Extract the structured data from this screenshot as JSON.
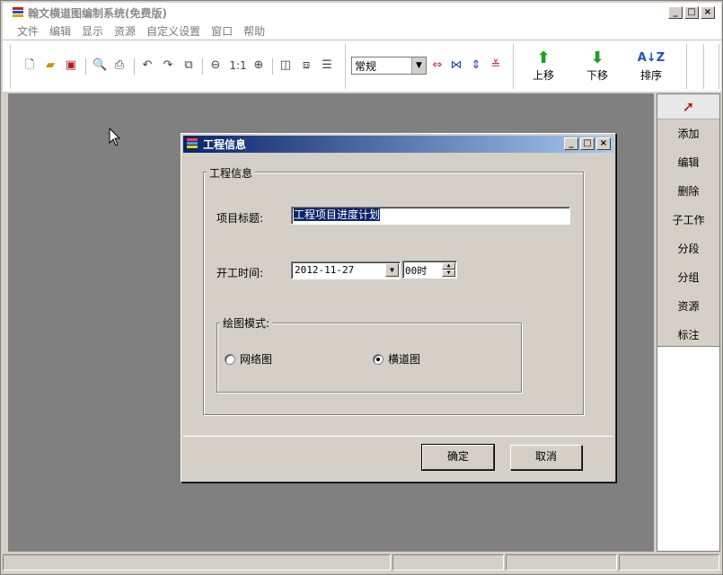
{
  "app": {
    "title": "翰文横道图编制系统(免费版)"
  },
  "menu": [
    "文件",
    "编辑",
    "显示",
    "资源",
    "自定义设置",
    "窗口",
    "帮助"
  ],
  "toolbar": {
    "zoom_label": "1:1",
    "style_combo": "常规",
    "move_up": "上移",
    "move_down": "下移",
    "sort": "排序"
  },
  "side_panel": {
    "items": [
      "添加",
      "编辑",
      "删除",
      "子工作",
      "分段",
      "分组",
      "资源",
      "标注"
    ]
  },
  "dialog": {
    "title": "工程信息",
    "group_label": "工程信息",
    "project_title_label": "项目标题:",
    "project_title_value": "工程项目进度计划",
    "start_time_label": "开工时间:",
    "start_date_value": "2012-11-27",
    "start_hour_value": "00时",
    "mode_group_label": "绘图模式:",
    "mode_network": "网络图",
    "mode_gantt": "横道图",
    "mode_selected": "横道图",
    "ok": "确定",
    "cancel": "取消"
  },
  "colors": {
    "dialog_title_start": "#0a246a",
    "dialog_title_end": "#a6caf0",
    "workspace": "#808080"
  }
}
